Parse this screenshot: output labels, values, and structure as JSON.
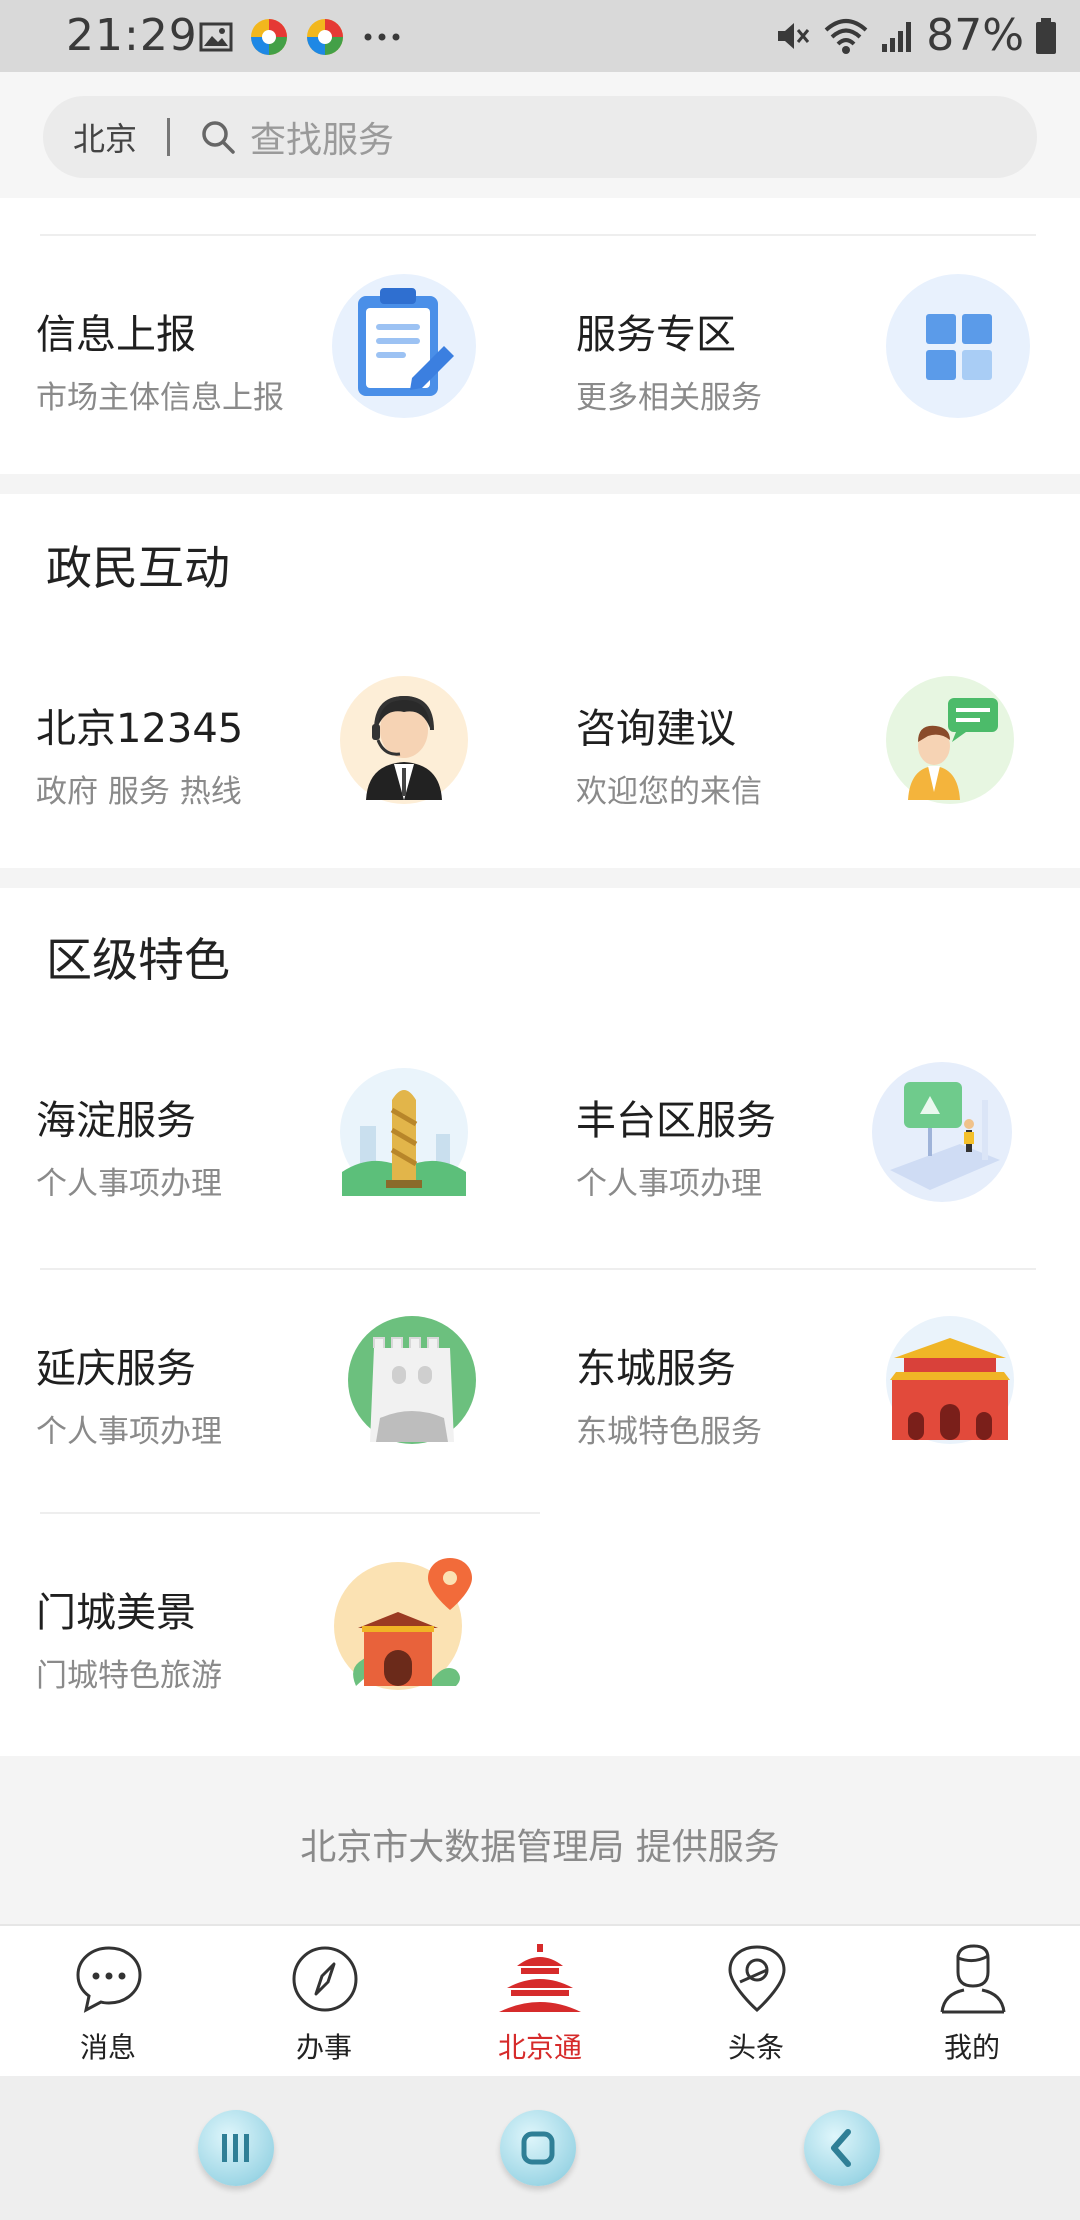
{
  "status_bar": {
    "time": "21:29",
    "battery": "87%"
  },
  "search": {
    "city": "北京",
    "placeholder": "查找服务"
  },
  "top_cards": [
    {
      "title": "信息上报",
      "subtitle": "市场主体信息上报",
      "icon": "clipboard-pen-icon"
    },
    {
      "title": "服务专区",
      "subtitle": "更多相关服务",
      "icon": "grid-icon"
    }
  ],
  "interaction": {
    "title": "政民互动",
    "cards": [
      {
        "title": "北京12345",
        "subtitle": "政府 服务 热线",
        "icon": "operator-headset-icon"
      },
      {
        "title": "咨询建议",
        "subtitle": "欢迎您的来信",
        "icon": "consult-chat-icon"
      }
    ]
  },
  "district": {
    "title": "区级特色",
    "cards": [
      {
        "title": "海淀服务",
        "subtitle": "个人事项办理",
        "icon": "haidian-tower-icon"
      },
      {
        "title": "丰台区服务",
        "subtitle": "个人事项办理",
        "icon": "fengtai-board-icon"
      },
      {
        "title": "延庆服务",
        "subtitle": "个人事项办理",
        "icon": "great-wall-icon"
      },
      {
        "title": "东城服务",
        "subtitle": "东城特色服务",
        "icon": "tiananmen-icon"
      },
      {
        "title": "门城美景",
        "subtitle": "门城特色旅游",
        "icon": "gate-location-icon"
      }
    ]
  },
  "footer": {
    "text": "北京市大数据管理局 提供服务"
  },
  "tabs": [
    {
      "label": "消息",
      "icon": "chat-bubble-icon",
      "active": false
    },
    {
      "label": "办事",
      "icon": "compass-icon",
      "active": false
    },
    {
      "label": "北京通",
      "icon": "temple-of-heaven-icon",
      "active": true
    },
    {
      "label": "头条",
      "icon": "location-pin-icon",
      "active": false
    },
    {
      "label": "我的",
      "icon": "user-profile-icon",
      "active": false
    }
  ],
  "colors": {
    "accent": "#d62b2b",
    "icon_blue": "#4a8fe8",
    "background_gray": "#f4f4f4"
  }
}
